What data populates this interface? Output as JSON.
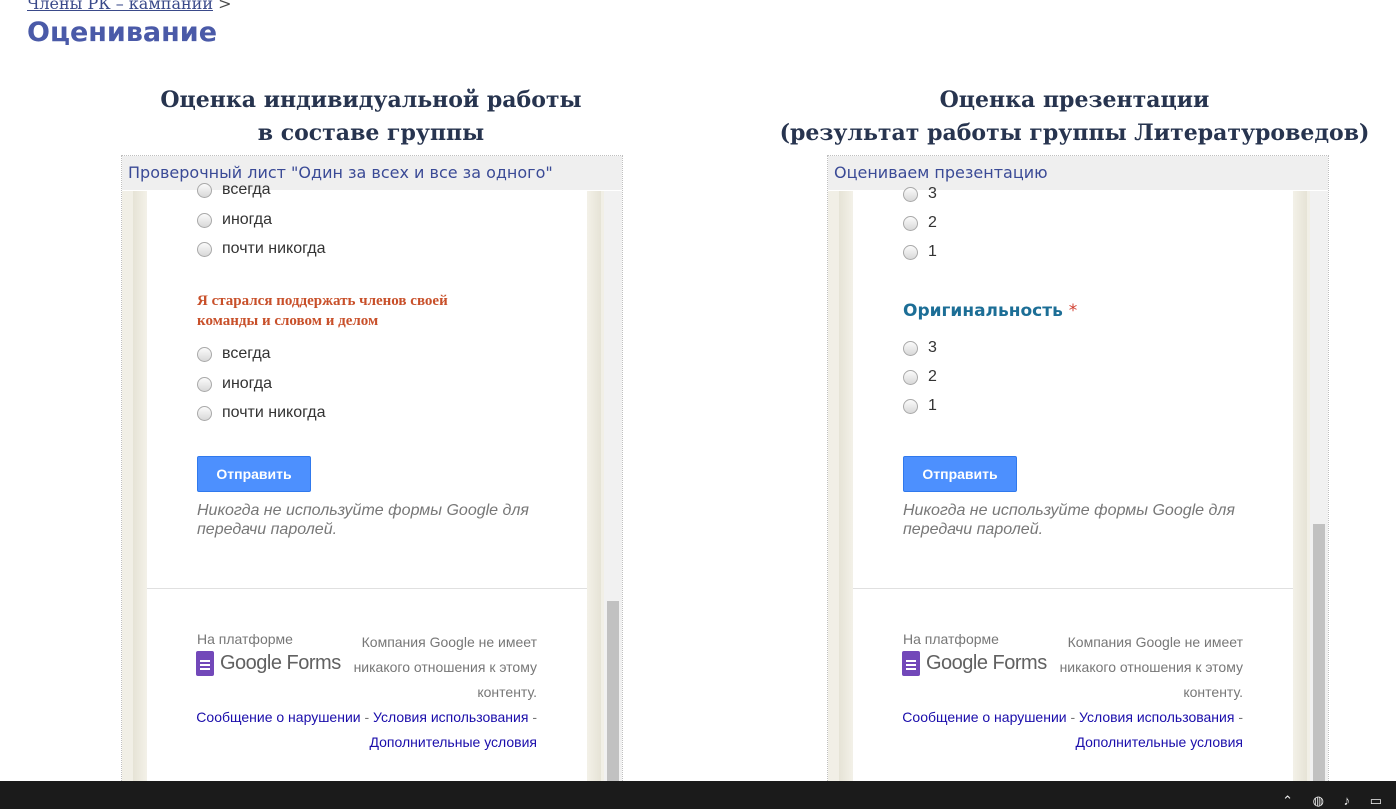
{
  "breadcrumb": {
    "link": "Члены РК – кампании",
    "separator": " >"
  },
  "page_title": "Оценивание",
  "left": {
    "heading_line1": "Оценка индивидуальной работы",
    "heading_line2": "в составе группы",
    "form_title": "Проверочный лист \"Один за всех и все за одного\"",
    "options_prev": [
      "всегда",
      "иногда",
      "почти никогда"
    ],
    "question": "Я старался поддержать членов своей команды и словом и делом",
    "options": [
      "всегда",
      "иногда",
      "почти никогда"
    ],
    "submit": "Отправить",
    "warning": "Никогда не используйте формы Google для передачи паролей."
  },
  "right": {
    "heading_line1": "Оценка презентации",
    "heading_line2": "(результат работы группы Литературоведов)",
    "form_title": "Оцениваем презентацию",
    "options_prev": [
      "3",
      "2",
      "1"
    ],
    "question": "Оригинальность",
    "required_mark": "*",
    "options": [
      "3",
      "2",
      "1"
    ],
    "submit": "Отправить",
    "warning": "Никогда не используйте формы Google для передачи паролей."
  },
  "footer": {
    "platform_label": "На платформе",
    "logo_text": "Google Forms",
    "disclaimer": "Компания Google не имеет никакого отношения к этому контенту.",
    "link_report": "Сообщение о нарушении",
    "link_terms": "Условия использования",
    "link_additional": "Дополнительные условия",
    "sep": " - "
  },
  "colors": {
    "title": "#4a5aa8",
    "question_red": "#c8502a",
    "question_blue": "#1c6e96",
    "button": "#4d90fe"
  }
}
